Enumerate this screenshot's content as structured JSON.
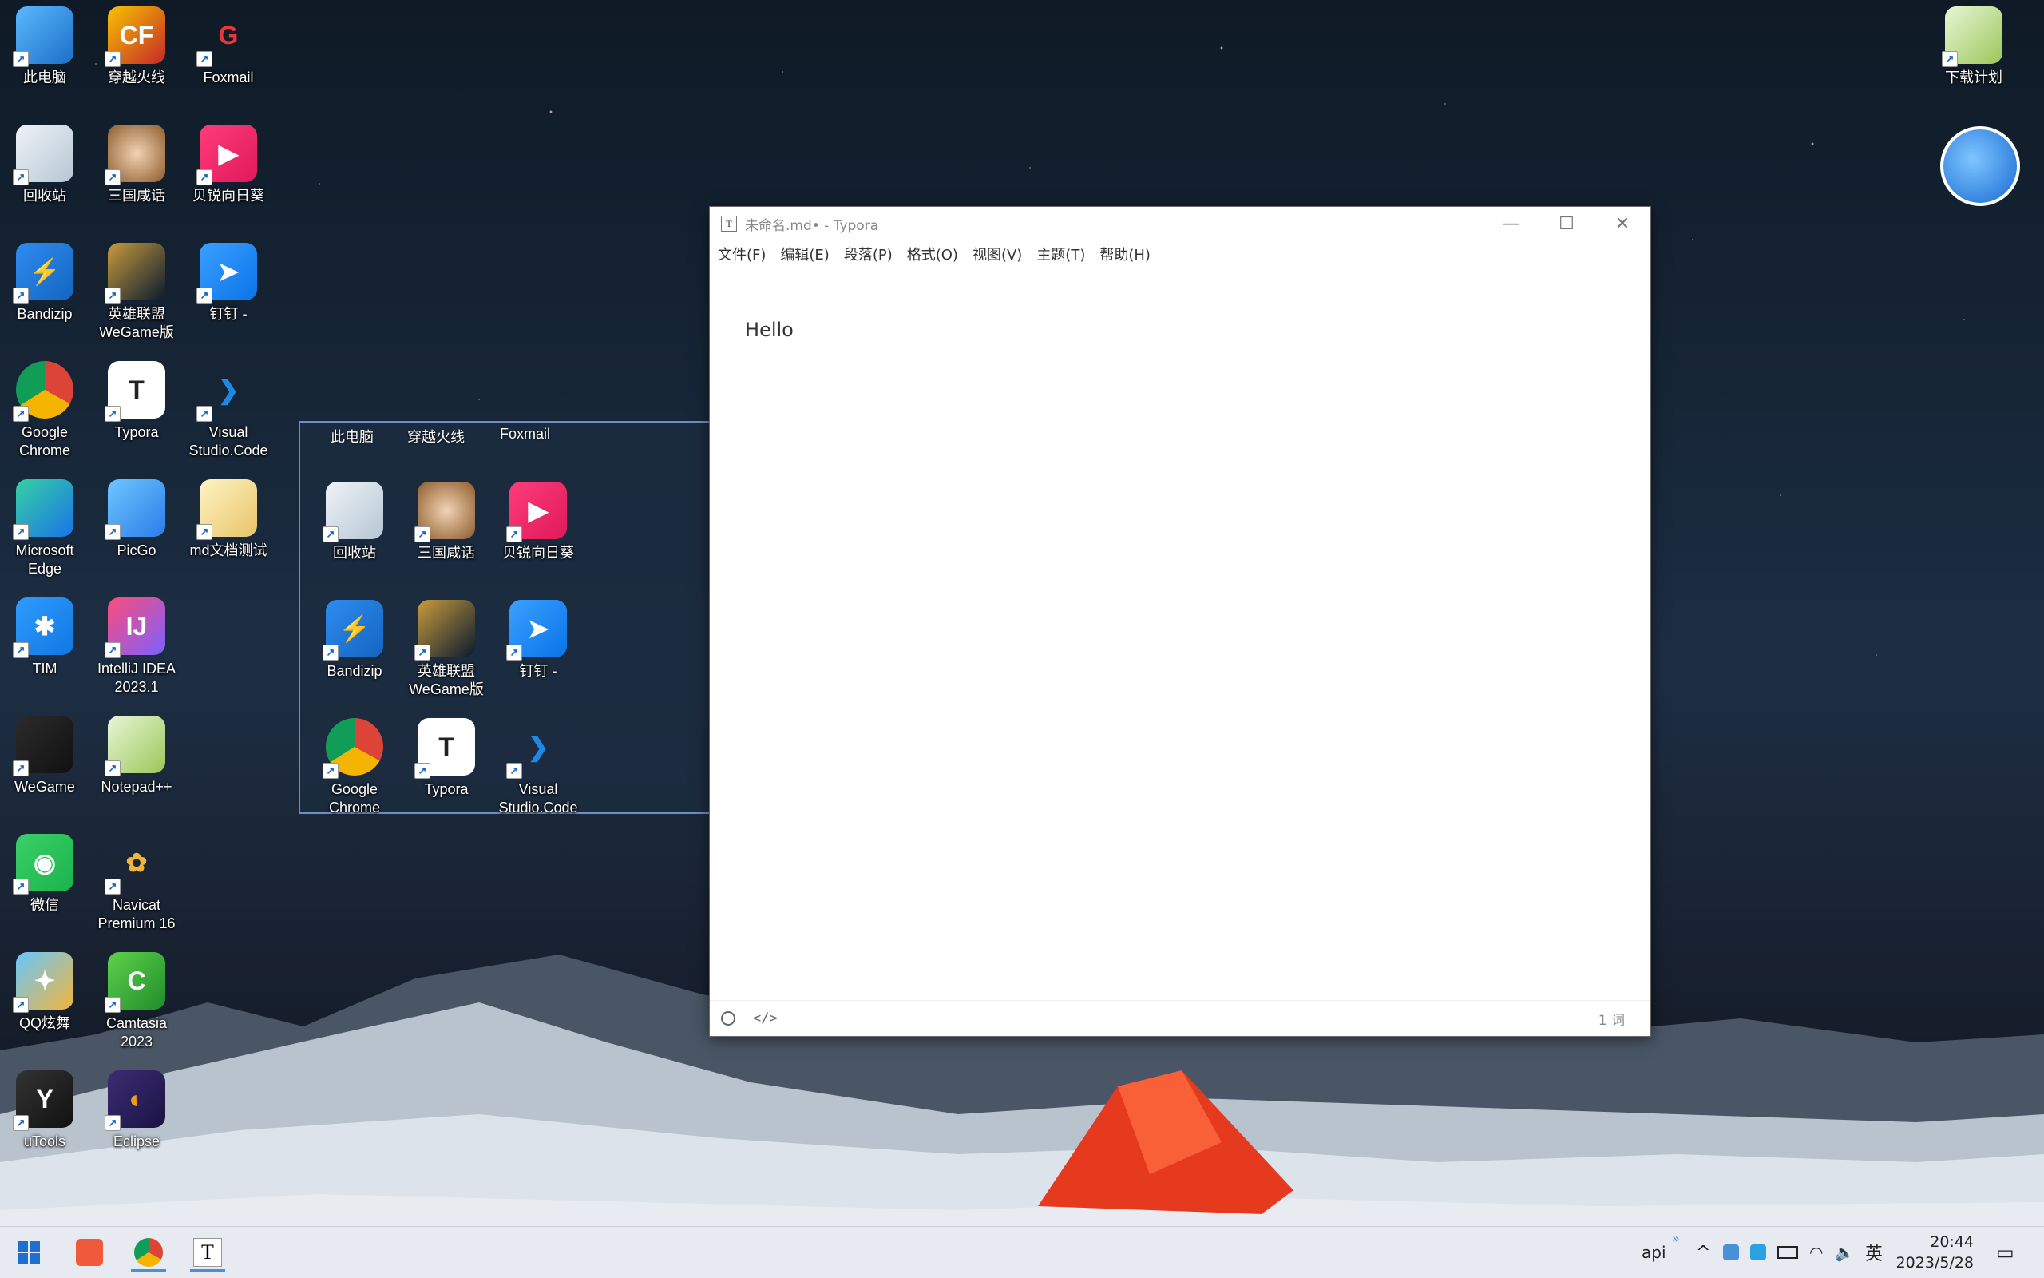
{
  "desktop": {
    "icons_col1": [
      {
        "label": "此电脑",
        "icon": "computer-icon"
      },
      {
        "label": "回收站",
        "icon": "recycle-bin-icon"
      },
      {
        "label": "Bandizip",
        "icon": "bandizip-icon"
      },
      {
        "label": "Google\nChrome",
        "icon": "chrome-icon"
      },
      {
        "label": "Microsoft\nEdge",
        "icon": "edge-icon"
      },
      {
        "label": "TIM",
        "icon": "tim-icon"
      },
      {
        "label": "WeGame",
        "icon": "wegame-icon"
      },
      {
        "label": "微信",
        "icon": "wechat-icon"
      },
      {
        "label": "QQ炫舞",
        "icon": "qq-dance-icon"
      },
      {
        "label": "uTools",
        "icon": "utools-icon"
      }
    ],
    "icons_col2": [
      {
        "label": "穿越火线",
        "icon": "crossfire-icon"
      },
      {
        "label": "三国咸话",
        "icon": "sanguo-icon"
      },
      {
        "label": "英雄联盟\nWeGame版",
        "icon": "lol-icon"
      },
      {
        "label": "Typora",
        "icon": "typora-icon"
      },
      {
        "label": "PicGo",
        "icon": "picgo-icon"
      },
      {
        "label": "IntelliJ IDEA\n2023.1",
        "icon": "intellij-icon"
      },
      {
        "label": "Notepad++",
        "icon": "notepadpp-icon"
      },
      {
        "label": "Navicat\nPremium 16",
        "icon": "navicat-icon"
      },
      {
        "label": "Camtasia\n2023",
        "icon": "camtasia-icon"
      },
      {
        "label": "Eclipse",
        "icon": "eclipse-icon"
      }
    ],
    "icons_col3": [
      {
        "label": "Foxmail",
        "icon": "foxmail-icon"
      },
      {
        "label": "贝锐向日葵",
        "icon": "sunlogin-icon"
      },
      {
        "label": "钉钉 -",
        "icon": "dingtalk-icon"
      },
      {
        "label": "Visual\nStudio.Code",
        "icon": "vscode-icon"
      },
      {
        "label": "md文档测试",
        "icon": "folder-icon"
      }
    ],
    "right_icons": [
      {
        "label": "下载计划",
        "icon": "download-plan-icon"
      }
    ]
  },
  "drag_panel": {
    "top_labels": [
      "此电脑",
      "穿越火线",
      "Foxmail"
    ],
    "row1": [
      {
        "label": "回收站",
        "icon": "recycle-bin-icon"
      },
      {
        "label": "三国咸话",
        "icon": "sanguo-icon"
      },
      {
        "label": "贝锐向日葵",
        "icon": "sunlogin-icon"
      }
    ],
    "row2": [
      {
        "label": "Bandizip",
        "icon": "bandizip-icon"
      },
      {
        "label": "英雄联盟\nWeGame版",
        "icon": "lol-icon"
      },
      {
        "label": "钉钉 -",
        "icon": "dingtalk-icon"
      }
    ],
    "row3": [
      {
        "label": "Google\nChrome",
        "icon": "chrome-icon"
      },
      {
        "label": "Typora",
        "icon": "typora-icon"
      },
      {
        "label": "Visual\nStudio.Code",
        "icon": "vscode-icon"
      }
    ]
  },
  "typora": {
    "title": "未命名.md• - Typora",
    "menu": [
      "文件(F)",
      "编辑(E)",
      "段落(P)",
      "格式(O)",
      "视图(V)",
      "主题(T)",
      "帮助(H)"
    ],
    "content": "Hello",
    "word_count": "1 词",
    "source_toggle": "</>"
  },
  "taskbar": {
    "tray_text": "api",
    "ime": "英",
    "time": "20:44",
    "date": "2023/5/28",
    "chevron": "»"
  },
  "colors": {
    "accent": "#4a90d9",
    "tent": "#e53a1e"
  }
}
